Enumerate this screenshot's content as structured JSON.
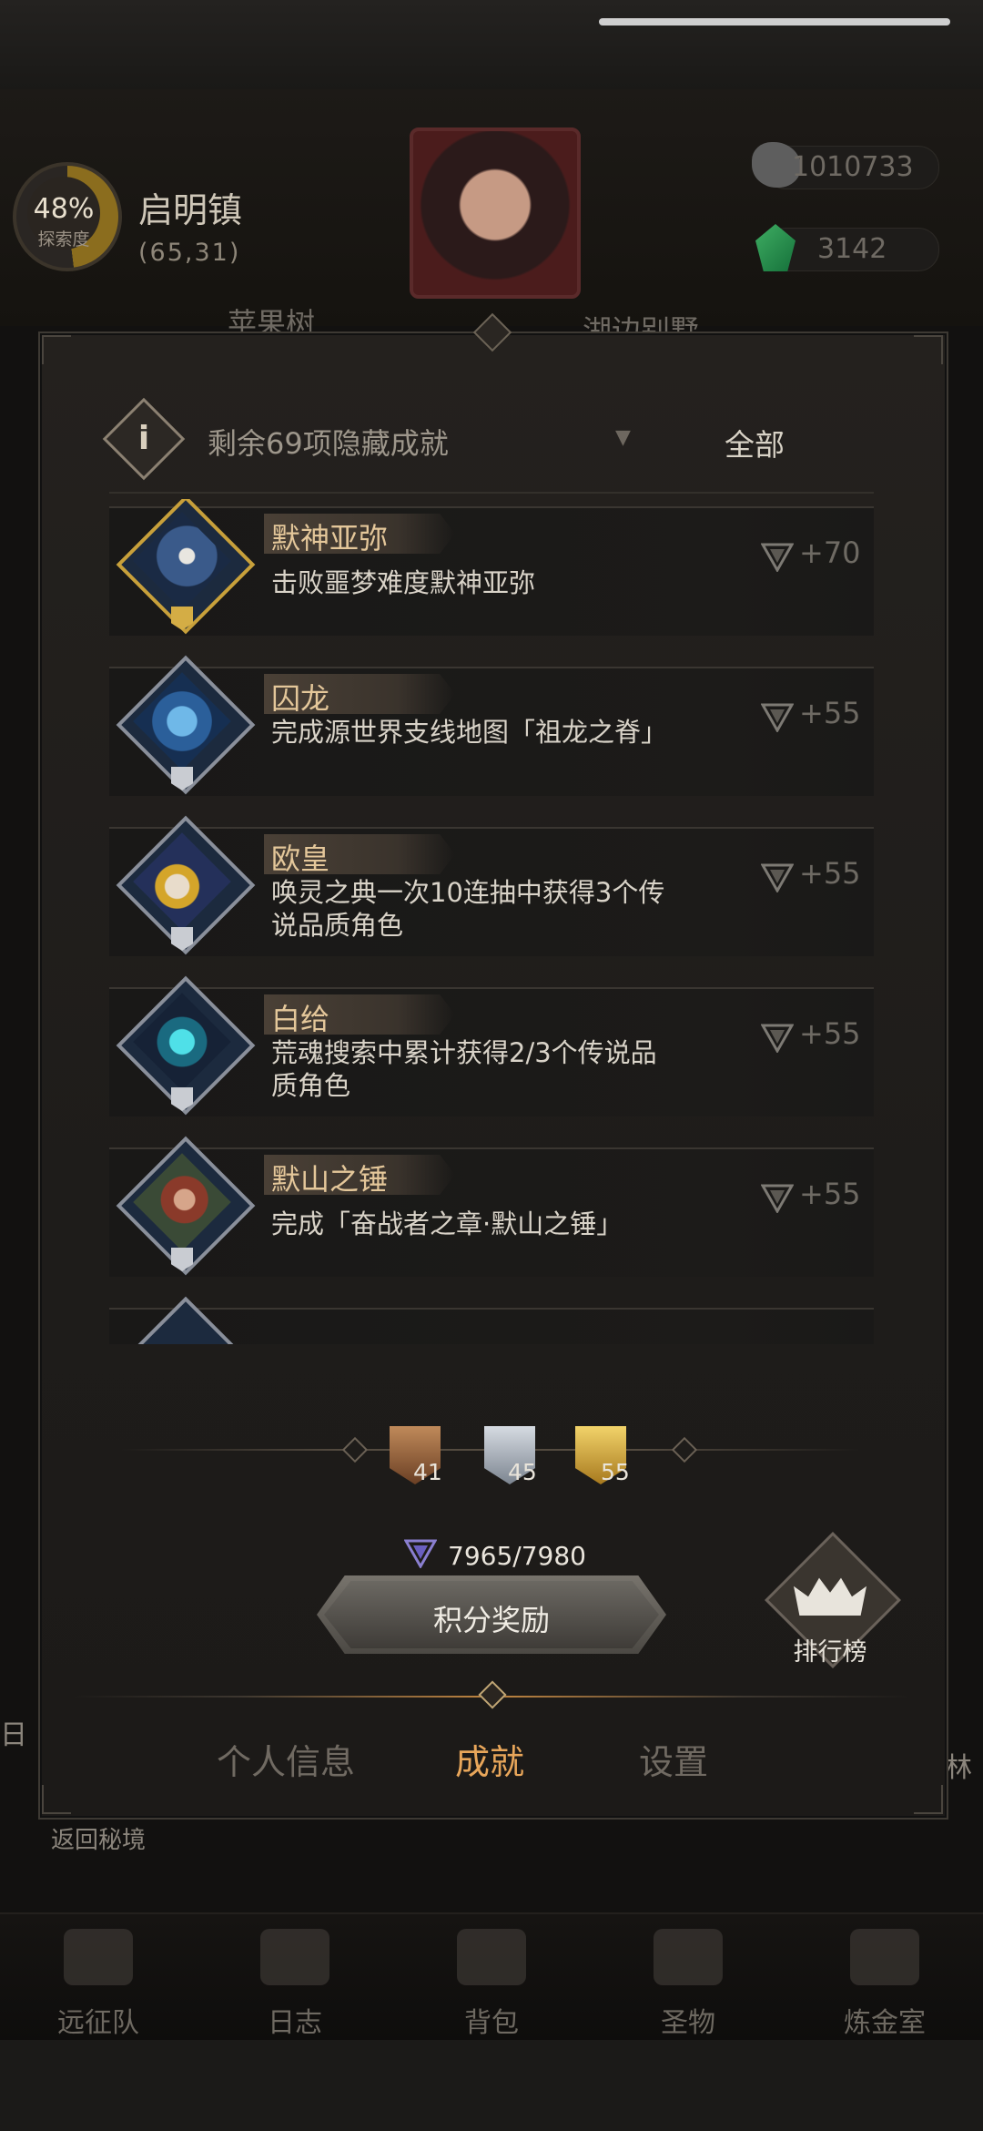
{
  "background": {
    "exploration": {
      "percent": "48%",
      "label": "探索度"
    },
    "location": {
      "name": "启明镇",
      "coords": "(65,31)"
    },
    "resources": [
      {
        "icon": "stone-icon",
        "value": "1010733"
      },
      {
        "icon": "emerald-icon",
        "value": "3142"
      }
    ],
    "map_labels": [
      "苹果树",
      "湖边别墅"
    ],
    "side_left": "日",
    "side_right": "林",
    "back_label": "返回秘境"
  },
  "panel": {
    "hidden_text": "剩余69项隐藏成就",
    "filter_value": "全部",
    "achievements": [
      {
        "name": "默神亚弥",
        "desc": "击败噩梦难度默神亚弥",
        "points": "+70",
        "tier": "gold",
        "icon": "silent-god-icon"
      },
      {
        "name": "囚龙",
        "desc": "完成源世界支线地图「祖龙之脊」",
        "points": "+55",
        "tier": "silver",
        "icon": "dragon-icon"
      },
      {
        "name": "欧皇",
        "desc": "唤灵之典一次10连抽中获得3个传说品质角色",
        "points": "+55",
        "tier": "silver",
        "icon": "crowned-king-icon"
      },
      {
        "name": "白给",
        "desc": "荒魂搜索中累计获得2/3个传说品质角色",
        "points": "+55",
        "tier": "silver",
        "icon": "spirit-flame-icon"
      },
      {
        "name": "默山之锤",
        "desc": "完成「奋战者之章·默山之锤」",
        "points": "+55",
        "tier": "silver",
        "icon": "dwarf-icon"
      }
    ],
    "tier_counts": [
      {
        "tier": "bronze",
        "count": "41"
      },
      {
        "tier": "silver",
        "count": "45"
      },
      {
        "tier": "gold",
        "count": "55"
      }
    ],
    "score": "7965/7980",
    "reward_button": "积分奖励",
    "leaderboard": "排行榜",
    "tabs": [
      {
        "label": "个人信息",
        "active": false
      },
      {
        "label": "成就",
        "active": true
      },
      {
        "label": "设置",
        "active": false
      }
    ]
  },
  "bottom_nav": [
    {
      "label": "远征队",
      "icon": "horned-helmet-icon"
    },
    {
      "label": "日志",
      "icon": "scroll-icon"
    },
    {
      "label": "背包",
      "icon": "backpack-icon"
    },
    {
      "label": "圣物",
      "icon": "relic-icon"
    },
    {
      "label": "炼金室",
      "icon": "alchemy-icon"
    }
  ],
  "colors": {
    "accent": "#e8a65a",
    "name_gold": "#e4c79a",
    "panel_bg": "#1e1c1a"
  }
}
